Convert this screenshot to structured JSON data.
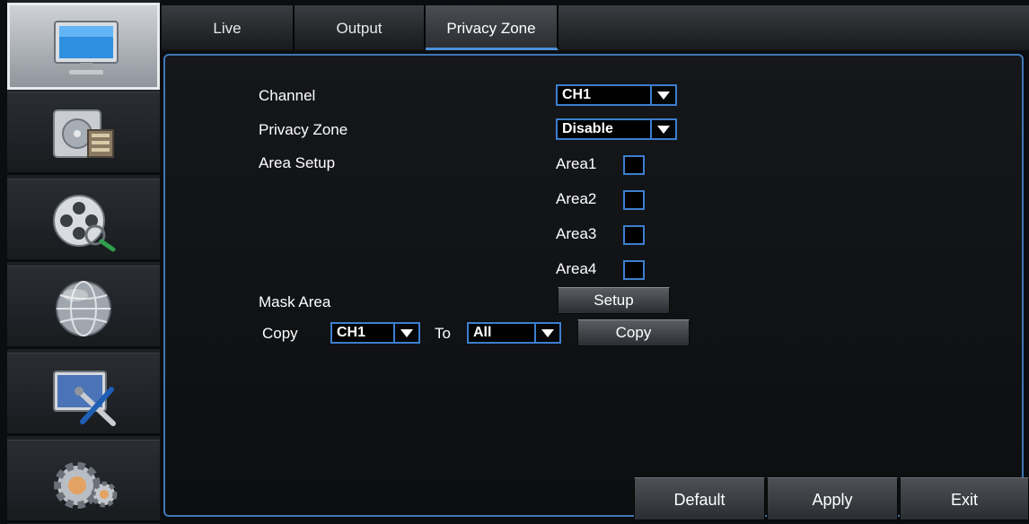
{
  "tabs": [
    {
      "label": "Live"
    },
    {
      "label": "Output"
    },
    {
      "label": "Privacy Zone",
      "active": true
    }
  ],
  "sidebar": {
    "items": [
      {
        "icon": "monitor-icon",
        "active": true
      },
      {
        "icon": "record-icon"
      },
      {
        "icon": "search-film-icon"
      },
      {
        "icon": "network-globe-icon"
      },
      {
        "icon": "system-tools-icon"
      },
      {
        "icon": "settings-gears-icon"
      }
    ]
  },
  "form": {
    "channel_label": "Channel",
    "channel_value": "CH1",
    "privacy_label": "Privacy Zone",
    "privacy_value": "Disable",
    "area_setup_label": "Area Setup",
    "areas": [
      "Area1",
      "Area2",
      "Area3",
      "Area4"
    ],
    "mask_label": "Mask Area",
    "setup_button": "Setup",
    "copy_label": "Copy",
    "copy_from_value": "CH1",
    "to_label": "To",
    "copy_to_value": "All",
    "copy_button": "Copy"
  },
  "footer": {
    "default_label": "Default",
    "apply_label": "Apply",
    "exit_label": "Exit"
  },
  "colors": {
    "accent": "#3c7fcf",
    "background": "#0b0d10"
  }
}
